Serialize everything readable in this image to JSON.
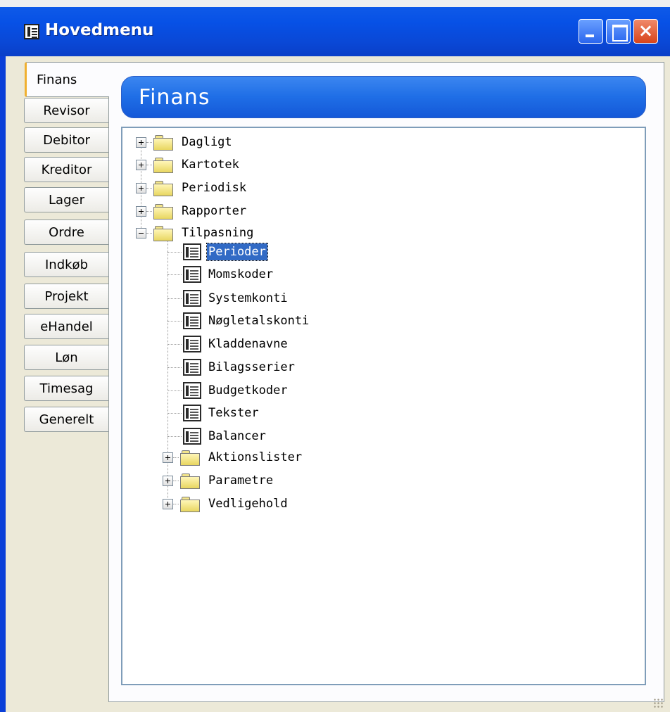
{
  "window": {
    "title": "Hovedmenu",
    "controls": {
      "minimize": "minimize",
      "maximize": "maximize",
      "close": "×"
    }
  },
  "tabs": [
    {
      "label": "Finans"
    },
    {
      "label": "Revisor"
    },
    {
      "label": "Debitor"
    },
    {
      "label": "Kreditor"
    },
    {
      "label": "Lager"
    },
    {
      "label": "Ordre"
    },
    {
      "label": "Indkøb"
    },
    {
      "label": "Projekt"
    },
    {
      "label": "eHandel"
    },
    {
      "label": "Løn"
    },
    {
      "label": "Timesag"
    },
    {
      "label": "Generelt"
    }
  ],
  "panel": {
    "header": "Finans"
  },
  "tree": {
    "root_items": [
      {
        "label": "Dagligt",
        "type": "folder",
        "state": "collapsed"
      },
      {
        "label": "Kartotek",
        "type": "folder",
        "state": "collapsed"
      },
      {
        "label": "Periodisk",
        "type": "folder",
        "state": "collapsed"
      },
      {
        "label": "Rapporter",
        "type": "folder",
        "state": "collapsed"
      },
      {
        "label": "Tilpasning",
        "type": "folder",
        "state": "expanded"
      }
    ],
    "tilpasning_children": [
      {
        "label": "Perioder",
        "type": "form",
        "selected": true
      },
      {
        "label": "Momskoder",
        "type": "form"
      },
      {
        "label": "Systemkonti",
        "type": "form"
      },
      {
        "label": "Nøgletalskonti",
        "type": "form"
      },
      {
        "label": "Kladdenavne",
        "type": "form"
      },
      {
        "label": "Bilagsserier",
        "type": "form"
      },
      {
        "label": "Budgetkoder",
        "type": "form"
      },
      {
        "label": "Tekster",
        "type": "form"
      },
      {
        "label": "Balancer",
        "type": "form"
      },
      {
        "label": "Aktionslister",
        "type": "folder",
        "state": "collapsed"
      },
      {
        "label": "Parametre",
        "type": "folder",
        "state": "collapsed"
      },
      {
        "label": "Vedligehold",
        "type": "folder",
        "state": "collapsed"
      }
    ]
  },
  "colors": {
    "selection": "#316ac5",
    "header_bar": "#1f6ee6",
    "active_tab_accent": "#f0b030"
  }
}
